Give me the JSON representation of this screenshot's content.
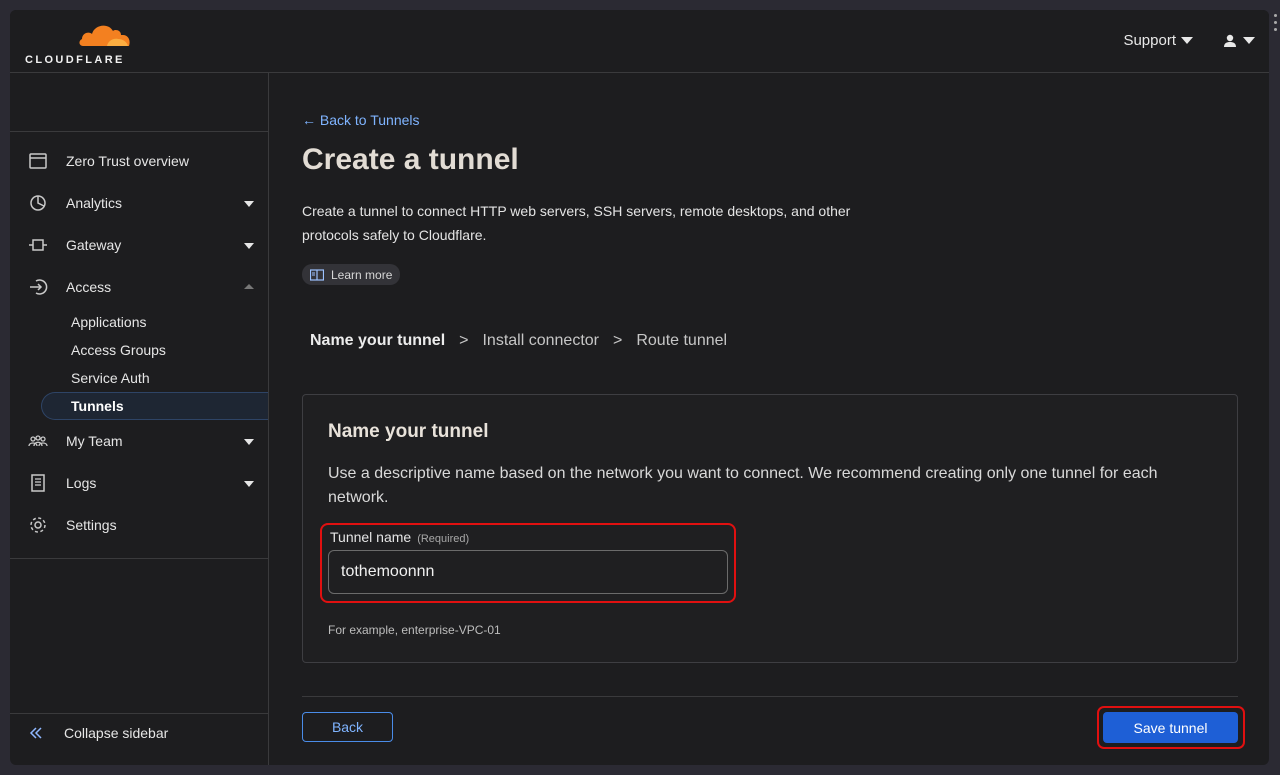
{
  "header": {
    "logo_text": "CLOUDFLARE",
    "support_label": "Support",
    "user_icon": "user-icon"
  },
  "sidebar": {
    "items": [
      {
        "label": "Zero Trust overview",
        "icon": "overview-icon"
      },
      {
        "label": "Analytics",
        "icon": "analytics-icon",
        "expandable": true
      },
      {
        "label": "Gateway",
        "icon": "gateway-icon",
        "expandable": true
      },
      {
        "label": "Access",
        "icon": "access-icon",
        "expanded": true
      }
    ],
    "access_sub": [
      {
        "label": "Applications"
      },
      {
        "label": "Access Groups"
      },
      {
        "label": "Service Auth"
      },
      {
        "label": "Tunnels",
        "active": true
      }
    ],
    "items_after": [
      {
        "label": "My Team",
        "icon": "team-icon",
        "expandable": true
      },
      {
        "label": "Logs",
        "icon": "logs-icon",
        "expandable": true
      },
      {
        "label": "Settings",
        "icon": "settings-icon"
      }
    ],
    "collapse_label": "Collapse sidebar"
  },
  "main": {
    "back_link": "← Back to Tunnels",
    "title": "Create a tunnel",
    "description": "Create a tunnel to connect HTTP web servers, SSH servers, remote desktops, and other protocols safely to Cloudflare.",
    "learn_more": "Learn more",
    "steps": [
      "Name your tunnel",
      "Install connector",
      "Route tunnel"
    ],
    "step_separator": ">",
    "card": {
      "title": "Name your tunnel",
      "description": "Use a descriptive name based on the network you want to connect. We recommend creating only one tunnel for each network.",
      "field_label": "Tunnel name",
      "field_required": "(Required)",
      "field_value": "tothemoonnn",
      "hint": "For example, enterprise-VPC-01"
    },
    "back_button": "Back",
    "save_button": "Save tunnel"
  },
  "colors": {
    "accent": "#1e5fd6",
    "link": "#7fb4ff",
    "highlight": "#e01010",
    "logo_orange": "#f38020"
  }
}
